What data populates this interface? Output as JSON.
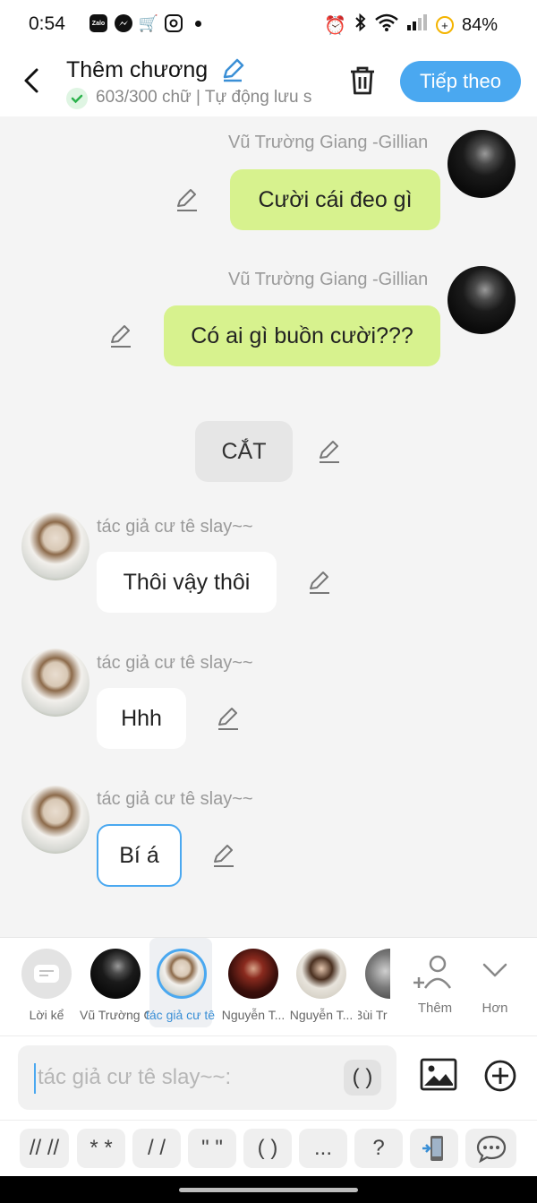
{
  "status_bar": {
    "time": "0:54",
    "app_icons": [
      "zalo-icon",
      "messenger-icon",
      "cart-icon",
      "instagram-icon"
    ],
    "zalo_label": "Zalo",
    "battery": "84%"
  },
  "header": {
    "title": "Thêm chương",
    "subtitle": "603/300 chữ | Tự động lưu s",
    "next_label": "Tiếp theo"
  },
  "messages": [
    {
      "side": "right",
      "author": "Vũ Trường Giang -Gillian",
      "text": "Cười cái đeo gì",
      "style": "green"
    },
    {
      "side": "right",
      "author": "Vũ Trường Giang -Gillian",
      "text": "Có ai gì buồn cười???",
      "style": "green"
    },
    {
      "side": "center",
      "author": "",
      "text": "CẮT",
      "style": "cut"
    },
    {
      "side": "left",
      "author": "tác giả cư tê slay~~",
      "text": "Thôi vậy thôi",
      "style": "white"
    },
    {
      "side": "left",
      "author": "tác giả cư tê slay~~",
      "text": "Hhh",
      "style": "white"
    },
    {
      "side": "left",
      "author": "tác giả cư tê slay~~",
      "text": "Bí á",
      "style": "selected"
    }
  ],
  "characters": [
    {
      "label": "Lời kể",
      "selected": false
    },
    {
      "label": "Vũ Trường Giang -Gillian",
      "selected": false
    },
    {
      "label": "tác giả cư tê slay~~",
      "selected": true
    },
    {
      "label": "Nguyễn T...",
      "selected": false
    },
    {
      "label": "Nguyễn T...",
      "selected": false
    },
    {
      "label": "Bùi Tr",
      "selected": false
    }
  ],
  "char_actions": {
    "add_label": "Thêm",
    "more_label": "Hơn"
  },
  "composer": {
    "placeholder": "tác giả cư tê slay~~:",
    "paren_label": "( )"
  },
  "format_buttons": [
    "// //",
    "* *",
    "/ /",
    "\" \"",
    "( )",
    "...",
    "?"
  ],
  "colors": {
    "accent": "#4aa8f0",
    "bubble_green": "#d7f28e",
    "chat_bg": "#f4f4f4"
  }
}
